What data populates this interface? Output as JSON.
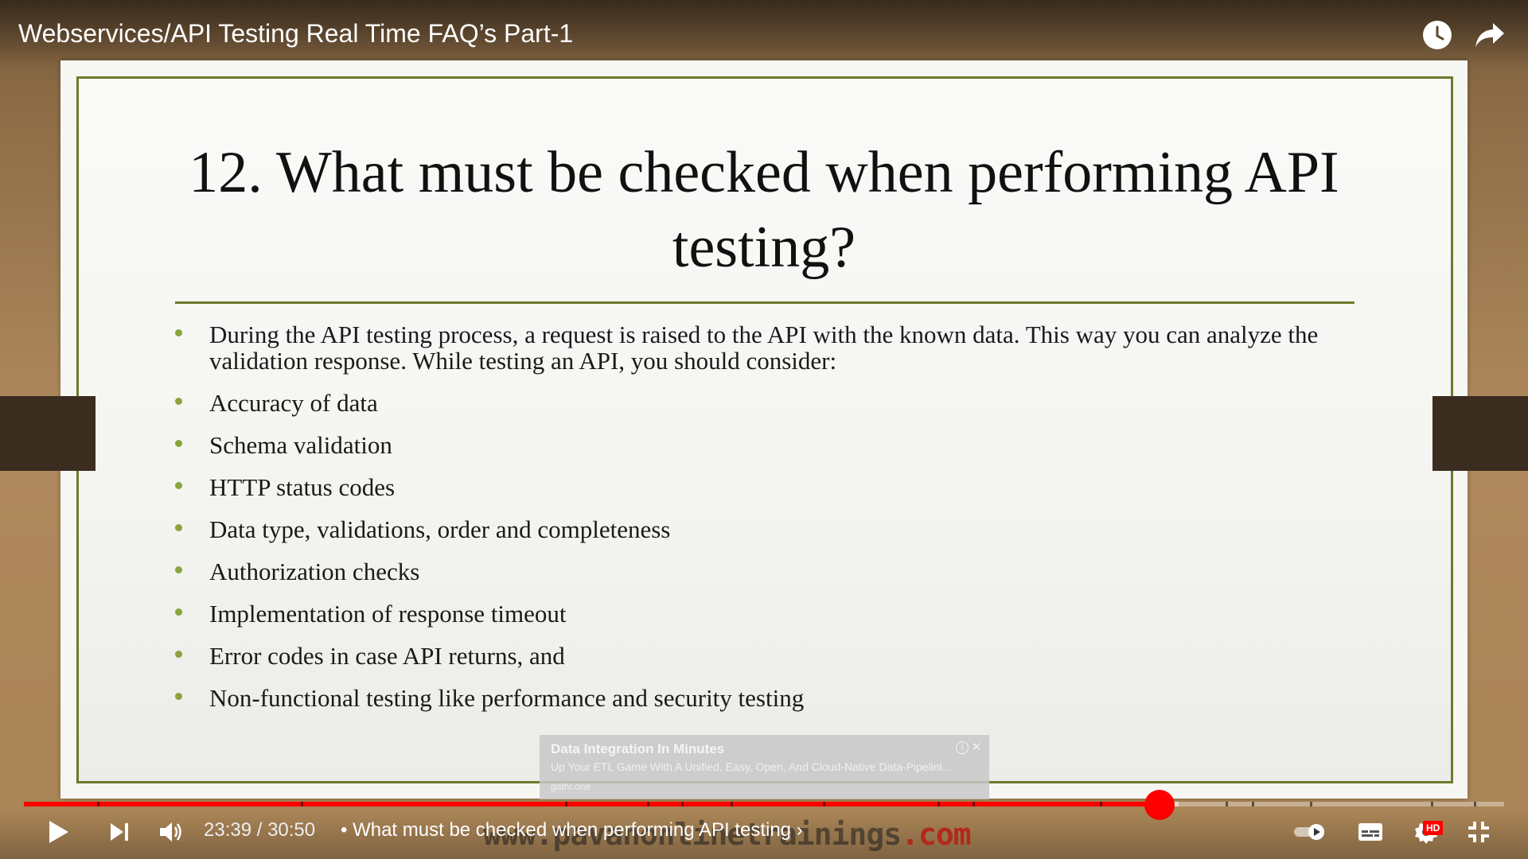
{
  "player": {
    "title": "Webservices/API Testing Real Time FAQ’s Part-1",
    "current_time": "23:39",
    "duration": "30:50",
    "time_display": "23:39 / 30:50",
    "chapter_separator": "•",
    "chapter_title": "What must be checked when performing API testing",
    "chapter_chevron": "›",
    "progress_fraction": 0.767,
    "buffered_fraction": 0.78,
    "quality_badge": "HD",
    "icons": {
      "watch_later": "clock-icon",
      "share": "share-arrow-icon",
      "play": "play-icon",
      "next": "next-icon",
      "volume": "volume-icon",
      "autoplay": "autoplay-toggle-icon",
      "subtitles": "subtitles-icon",
      "settings": "gear-icon",
      "exit_fullscreen": "exit-fullscreen-icon"
    },
    "accent_color": "#ff0000"
  },
  "slide": {
    "title": "12. What must be checked when performing API testing?",
    "intro": "During the API testing process, a request is raised to the API with the known data. This way you can analyze the validation response. While testing an API, you should consider:",
    "items": [
      "Accuracy of data",
      "Schema validation",
      "HTTP status codes",
      "Data type, validations, order and completeness",
      "Authorization checks",
      "Implementation of response timeout",
      "Error codes in case API returns, and",
      "Non-functional testing like performance and security testing"
    ],
    "accent_color": "#6d7a2c",
    "bullet_color": "#8aa33d"
  },
  "ad": {
    "title": "Data Integration In Minutes",
    "body": "Up Your ETL Game With A Unified, Easy, Open, And Cloud-Native Data-Pipelini...",
    "domain": "gathr.one",
    "info_symbol": "i",
    "close_symbol": "✕"
  },
  "watermark": {
    "text": "www.pavanonlinetrainings",
    "suffix": ".com"
  }
}
